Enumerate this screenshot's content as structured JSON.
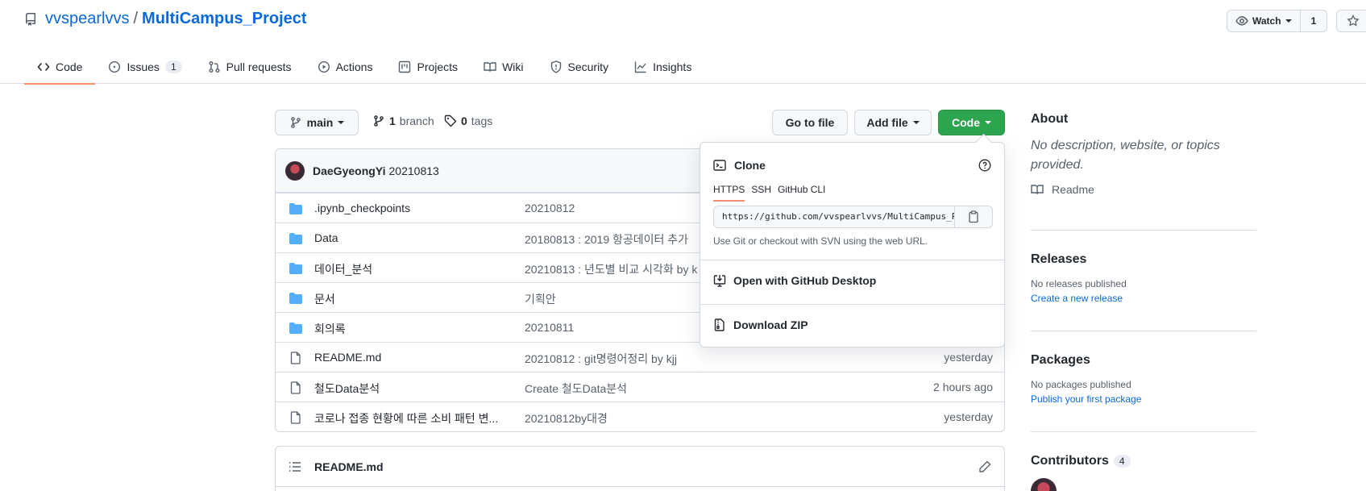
{
  "repo": {
    "owner": "vvspearlvvs",
    "separator": "/",
    "name": "MultiCampus_Project"
  },
  "watch": {
    "label": "Watch",
    "count": "1"
  },
  "tabs": [
    {
      "label": "Code",
      "icon": "code-icon",
      "active": true
    },
    {
      "label": "Issues",
      "icon": "issue-icon",
      "count": "1"
    },
    {
      "label": "Pull requests",
      "icon": "pull-request-icon"
    },
    {
      "label": "Actions",
      "icon": "play-icon"
    },
    {
      "label": "Projects",
      "icon": "project-icon"
    },
    {
      "label": "Wiki",
      "icon": "book-icon"
    },
    {
      "label": "Security",
      "icon": "shield-icon"
    },
    {
      "label": "Insights",
      "icon": "graph-icon"
    }
  ],
  "toolbar": {
    "branch": "main",
    "branch_count": "1",
    "branch_label": "branch",
    "tag_count": "0",
    "tag_label": "tags",
    "go_to_file": "Go to file",
    "add_file": "Add file",
    "code": "Code"
  },
  "latest_commit": {
    "author": "DaeGyeongYi",
    "message": "20210813"
  },
  "files": [
    {
      "type": "dir",
      "name": ".ipynb_checkpoints",
      "message": "20210812",
      "age": ""
    },
    {
      "type": "dir",
      "name": "Data",
      "message": "20180813 : 2019 항공데이터 추가",
      "age": ""
    },
    {
      "type": "dir",
      "name": "데이터_분석",
      "message": "20210813 : 년도별 비교 시각화 by k",
      "age": ""
    },
    {
      "type": "dir",
      "name": "문서",
      "message": "기획안",
      "age": ""
    },
    {
      "type": "dir",
      "name": "회의록",
      "message": "20210811",
      "age": ""
    },
    {
      "type": "file",
      "name": "README.md",
      "message": "20210812 : git명령어정리 by kjj",
      "age": "yesterday"
    },
    {
      "type": "file",
      "name": "철도Data분석",
      "message": "Create 철도Data분석",
      "age": "2 hours ago"
    },
    {
      "type": "file",
      "name": "코로나 접종 현황에 따른 소비 패턴 변...",
      "message": "20210812by대경",
      "age": "yesterday"
    }
  ],
  "readme": {
    "title": "README.md"
  },
  "clone": {
    "title": "Clone",
    "tabs": [
      "HTTPS",
      "SSH",
      "GitHub CLI"
    ],
    "url": "https://github.com/vvspearlvvs/MultiCampus_Project.git",
    "hint": "Use Git or checkout with SVN using the web URL.",
    "open_desktop": "Open with GitHub Desktop",
    "download_zip": "Download ZIP"
  },
  "about": {
    "title": "About",
    "description": "No description, website, or topics provided.",
    "readme_link": "Readme"
  },
  "releases": {
    "title": "Releases",
    "empty": "No releases published",
    "create": "Create a new release"
  },
  "packages": {
    "title": "Packages",
    "empty": "No packages published",
    "publish": "Publish your first package"
  },
  "contributors": {
    "title": "Contributors",
    "count": "4"
  },
  "colors": {
    "accent": "#0969da",
    "green": "#2da44e",
    "tab_underline": "#fd8c73",
    "folder": "#54aeff"
  }
}
